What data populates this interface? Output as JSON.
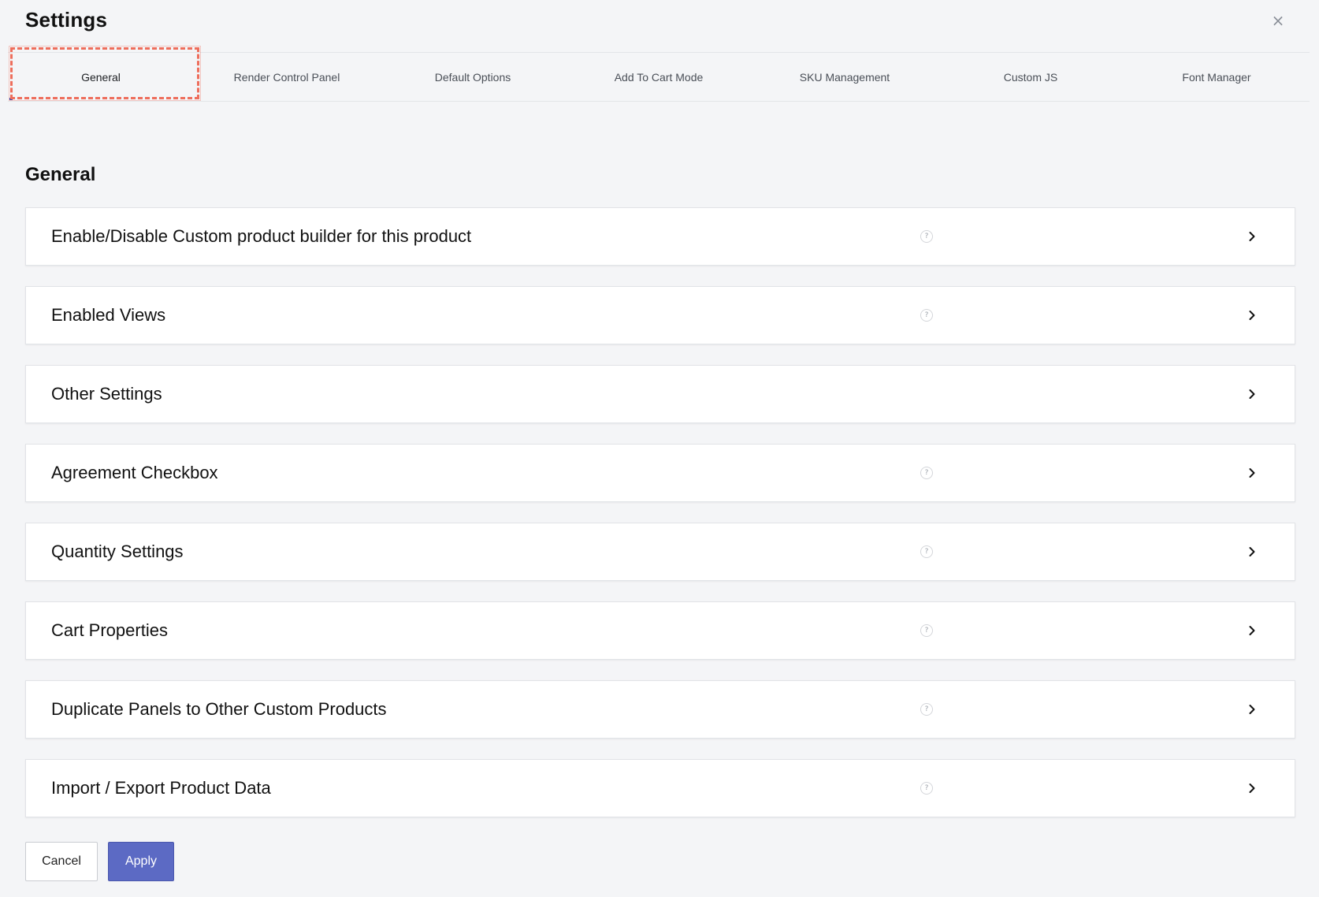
{
  "header": {
    "title": "Settings",
    "close_glyph": "×"
  },
  "tabs": [
    {
      "label": "General",
      "active": true
    },
    {
      "label": "Render Control Panel",
      "active": false
    },
    {
      "label": "Default Options",
      "active": false
    },
    {
      "label": "Add To Cart Mode",
      "active": false
    },
    {
      "label": "SKU Management",
      "active": false
    },
    {
      "label": "Custom JS",
      "active": false
    },
    {
      "label": "Font Manager",
      "active": false
    }
  ],
  "section": {
    "title": "General"
  },
  "panels": [
    {
      "label": "Enable/Disable Custom product builder for this product",
      "help": true
    },
    {
      "label": "Enabled Views",
      "help": true
    },
    {
      "label": "Other Settings",
      "help": false
    },
    {
      "label": "Agreement Checkbox",
      "help": true
    },
    {
      "label": "Quantity Settings",
      "help": true
    },
    {
      "label": "Cart Properties",
      "help": true
    },
    {
      "label": "Duplicate Panels to Other Custom Products",
      "help": true
    },
    {
      "label": "Import / Export Product Data",
      "help": true
    }
  ],
  "help_glyph": "?",
  "footer": {
    "cancel_label": "Cancel",
    "apply_label": "Apply"
  },
  "colors": {
    "accent": "#5c6ac4",
    "highlight": "#ee6e5c",
    "background": "#f4f5f7"
  },
  "icons": {
    "close": "close-icon",
    "help": "help-icon",
    "chevron": "chevron-right-icon"
  }
}
